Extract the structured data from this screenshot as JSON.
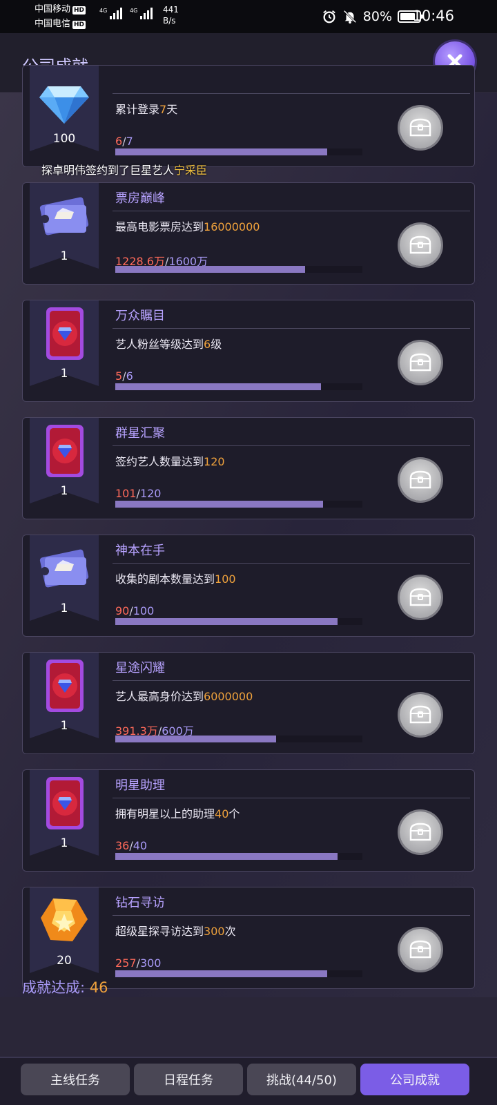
{
  "status_bar": {
    "carrier1": "中国移动",
    "carrier2": "中国电信",
    "hd": "HD",
    "net1": "4G",
    "net2": "4G",
    "speed_value": "441",
    "speed_unit": "B/s",
    "battery": "80%",
    "battery_level": 0.8,
    "time": "10:46"
  },
  "header": {
    "title": "公司成就"
  },
  "marquee": {
    "prefix": "探卓明伟签约到了巨星艺人",
    "highlight": "宁采臣"
  },
  "achievements": [
    {
      "title": "",
      "desc_pre": "累计登录",
      "desc_hl": "7",
      "desc_post": "天",
      "current": "6",
      "total": "7",
      "progress": 0.857,
      "reward_icon": "diamond-icon",
      "reward_count": "100"
    },
    {
      "title": "票房巅峰",
      "desc_pre": "最高电影票房达到",
      "desc_hl": "16000000",
      "desc_post": "",
      "current": "1228.6万",
      "total": "1600万",
      "progress": 0.768,
      "reward_icon": "ticket-icon",
      "reward_count": "1"
    },
    {
      "title": "万众瞩目",
      "desc_pre": "艺人粉丝等级达到",
      "desc_hl": "6",
      "desc_post": "级",
      "current": "5",
      "total": "6",
      "progress": 0.833,
      "reward_icon": "card-icon",
      "reward_count": "1"
    },
    {
      "title": "群星汇聚",
      "desc_pre": "签约艺人数量达到",
      "desc_hl": "120",
      "desc_post": "",
      "current": "101",
      "total": "120",
      "progress": 0.842,
      "reward_icon": "card-icon",
      "reward_count": "1"
    },
    {
      "title": "神本在手",
      "desc_pre": "收集的剧本数量达到",
      "desc_hl": "100",
      "desc_post": "",
      "current": "90",
      "total": "100",
      "progress": 0.9,
      "reward_icon": "ticket-icon",
      "reward_count": "1"
    },
    {
      "title": "星途闪耀",
      "desc_pre": "艺人最高身价达到",
      "desc_hl": "6000000",
      "desc_post": "",
      "current": "391.3万",
      "total": "600万",
      "progress": 0.652,
      "reward_icon": "card-icon",
      "reward_count": "1"
    },
    {
      "title": "明星助理",
      "desc_pre": "拥有明星以上的助理",
      "desc_hl": "40",
      "desc_post": "个",
      "current": "36",
      "total": "40",
      "progress": 0.9,
      "reward_icon": "card-icon",
      "reward_count": "1"
    },
    {
      "title": "钻石寻访",
      "desc_pre": "超级星探寻访达到",
      "desc_hl": "300",
      "desc_post": "次",
      "current": "257",
      "total": "300",
      "progress": 0.857,
      "reward_icon": "gem-icon",
      "reward_count": "20"
    }
  ],
  "summary": {
    "label": "成就达成:",
    "value": "46"
  },
  "tabs": [
    {
      "label": "主线任务",
      "active": false
    },
    {
      "label": "日程任务",
      "active": false
    },
    {
      "label": "挑战(44/50)",
      "active": false
    },
    {
      "label": "公司成就",
      "active": true
    }
  ],
  "colors": {
    "accent": "#7b5de6",
    "highlight": "#f0a23c",
    "progress_current": "#ff6a5a",
    "progress_total": "#a99af7"
  }
}
